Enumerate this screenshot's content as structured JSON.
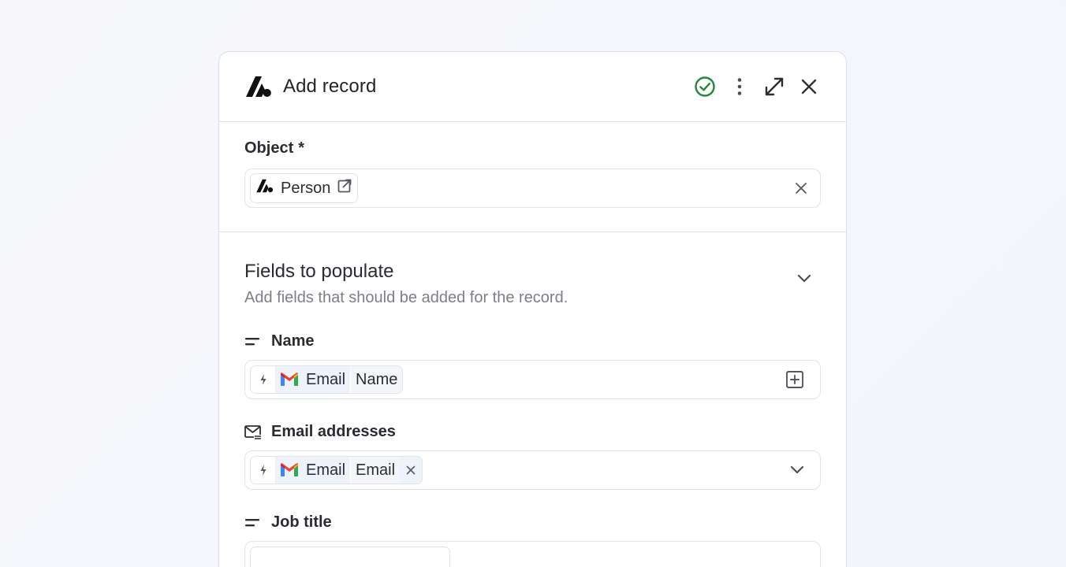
{
  "panel": {
    "title": "Add record",
    "header_icons": [
      "status-check-icon",
      "more-vertical-icon",
      "expand-icon",
      "close-icon"
    ]
  },
  "object_section": {
    "label": "Object",
    "required_mark": "*",
    "selected": "Person"
  },
  "fields_section": {
    "title": "Fields to populate",
    "subtitle": "Add fields that should be added for the record.",
    "fields": [
      {
        "label": "Name",
        "token_source": "Email",
        "token_field": "Name"
      },
      {
        "label": "Email addresses",
        "token_source": "Email",
        "token_field": "Email"
      },
      {
        "label": "Job title"
      }
    ]
  },
  "colors": {
    "accent_green": "#1e8a3a",
    "border": "#dfe3ea",
    "panel_border": "#d3def3",
    "muted_text": "#7c7f86"
  }
}
